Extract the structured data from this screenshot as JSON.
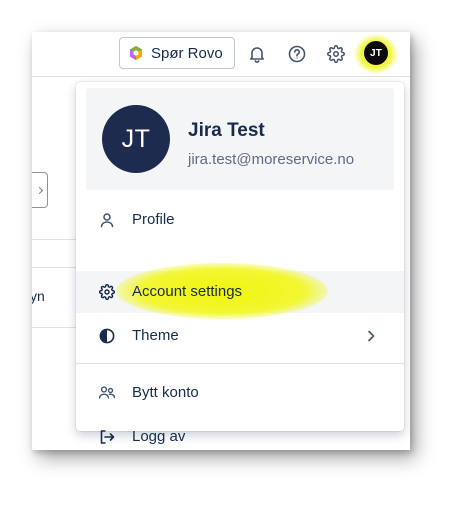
{
  "topbar": {
    "rovo_button_label": "Spør Rovo",
    "user_initials": "JT",
    "icons": [
      "notification-icon",
      "help-icon",
      "settings-icon"
    ]
  },
  "background": {
    "partial_text": "yn"
  },
  "profile": {
    "initials": "JT",
    "name": "Jira Test",
    "email": "jira.test@moreservice.no"
  },
  "menu": {
    "items": [
      {
        "label": "Profile",
        "icon": "person-icon"
      },
      {
        "label": "Account settings",
        "icon": "gear-icon",
        "highlighted": true
      },
      {
        "label": "Theme",
        "icon": "theme-icon",
        "has_submenu": true
      },
      {
        "label": "Bytt konto",
        "icon": "switch-account-icon"
      },
      {
        "label": "Logg av",
        "icon": "logout-icon"
      }
    ]
  },
  "colors": {
    "highlight": "#f0f500",
    "avatar_large_bg": "#1d2b4f",
    "avatar_small_bg": "#0b0b0b",
    "menu_hover_bg": "#f4f5f7"
  }
}
